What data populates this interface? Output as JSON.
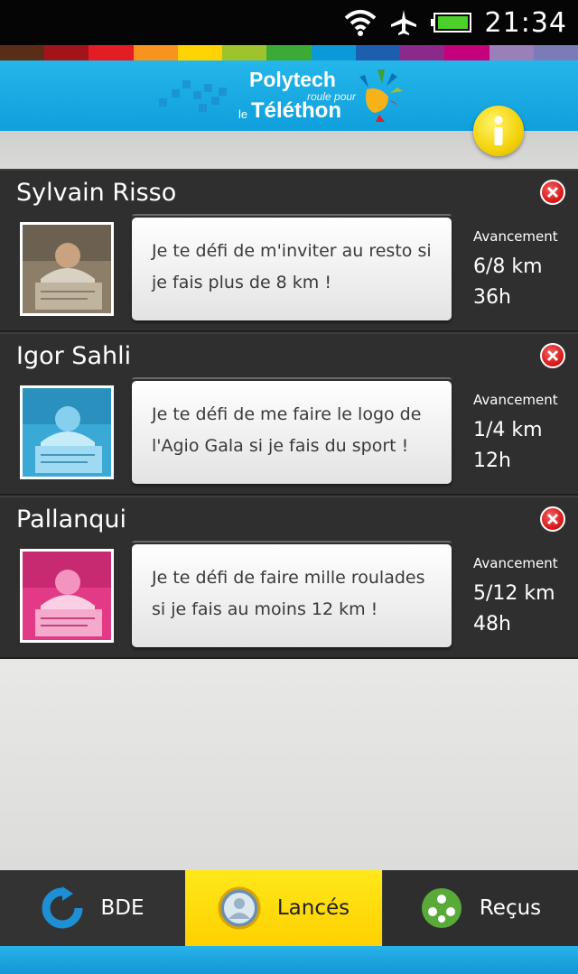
{
  "status_bar": {
    "time": "21:34",
    "icons": [
      "wifi-icon",
      "airplane-icon",
      "battery-icon"
    ]
  },
  "color_strip": [
    "#5a2d16",
    "#a3141a",
    "#e41d25",
    "#f7931e",
    "#ffd400",
    "#9dc42c",
    "#3caa36",
    "#0b9ad7",
    "#1d5fae",
    "#8b2a8b",
    "#c7007e",
    "#9a7fb8",
    "#7b7bb8"
  ],
  "header": {
    "logo_line1": "Polytech",
    "logo_line2": "roule pour",
    "logo_line3": "le",
    "logo_line4": "Téléthon",
    "info_icon": "info-icon"
  },
  "challenges": [
    {
      "name": "Sylvain Risso",
      "message": "Je te défi de m'inviter au resto si je fais plus de 8 km !",
      "progress_label": "Avancement",
      "distance": "6/8 km",
      "time": "36h",
      "avatar_tint": "#b8a890"
    },
    {
      "name": "Igor Sahli",
      "message": "Je te défi de me faire le logo de l'Agio Gala si je fais du sport !",
      "progress_label": "Avancement",
      "distance": "1/4 km",
      "time": "12h",
      "avatar_tint": "#4ab8e2"
    },
    {
      "name": "Pallanqui",
      "message": "Je te défi de faire mille roulades si je fais au moins 12 km !",
      "progress_label": "Avancement",
      "distance": "5/12 km",
      "time": "48h",
      "avatar_tint": "#ea3c8a"
    }
  ],
  "tabs": [
    {
      "label": "BDE",
      "icon": "refresh-icon",
      "selected": false
    },
    {
      "label": "Lancés",
      "icon": "user-icon",
      "selected": true
    },
    {
      "label": "Reçus",
      "icon": "group-icon",
      "selected": false
    }
  ],
  "colors": {
    "accent_blue": "#1aa6e2",
    "tab_selected": "#ffd400",
    "card_bg": "#2f2f2f",
    "close_red": "#d41414"
  }
}
